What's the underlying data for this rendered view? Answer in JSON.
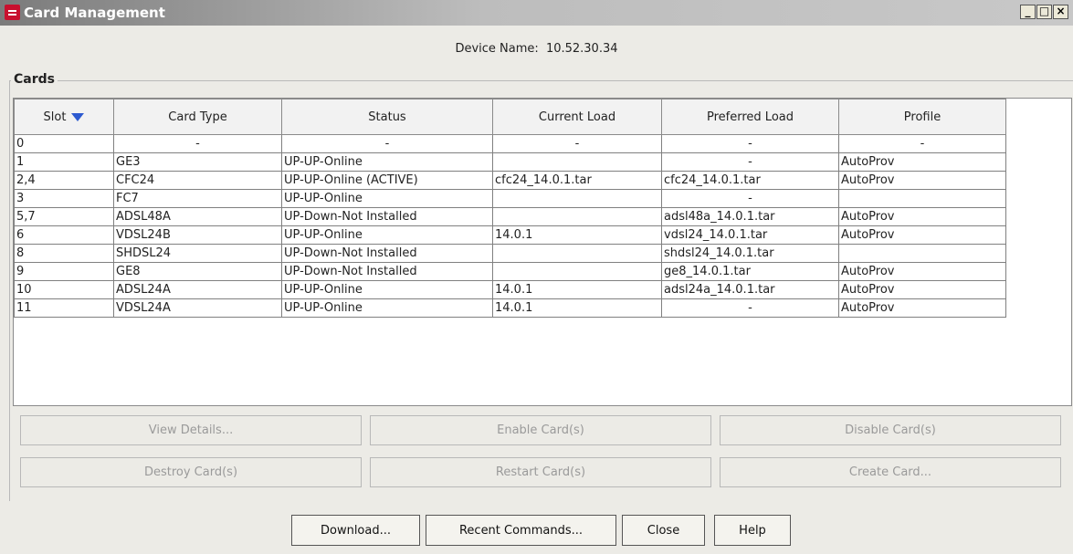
{
  "window": {
    "title": "Card Management",
    "controls": {
      "minimize": "_",
      "maximize": "□",
      "close": "×"
    }
  },
  "device": {
    "label": "Device Name:",
    "value": "10.52.30.34"
  },
  "cards_group": {
    "label": "Cards"
  },
  "table": {
    "columns": [
      "Slot",
      "Card Type",
      "Status",
      "Current Load",
      "Preferred Load",
      "Profile"
    ],
    "sort_column": "Slot",
    "sort_direction": "descending",
    "rows": [
      [
        "0",
        "-",
        "-",
        "-",
        "-",
        "-"
      ],
      [
        "1",
        "GE3",
        "UP-UP-Online",
        "",
        "-",
        "AutoProv"
      ],
      [
        "2,4",
        "CFC24",
        "UP-UP-Online (ACTIVE)",
        "cfc24_14.0.1.tar",
        "cfc24_14.0.1.tar",
        "AutoProv"
      ],
      [
        "3",
        "FC7",
        "UP-UP-Online",
        "",
        "-",
        ""
      ],
      [
        "5,7",
        "ADSL48A",
        "UP-Down-Not Installed",
        "",
        "adsl48a_14.0.1.tar",
        "AutoProv"
      ],
      [
        "6",
        "VDSL24B",
        "UP-UP-Online",
        "14.0.1",
        "vdsl24_14.0.1.tar",
        "AutoProv"
      ],
      [
        "8",
        "SHDSL24",
        "UP-Down-Not Installed",
        "",
        "shdsl24_14.0.1.tar",
        ""
      ],
      [
        "9",
        "GE8",
        "UP-Down-Not Installed",
        "",
        "ge8_14.0.1.tar",
        "AutoProv"
      ],
      [
        "10",
        "ADSL24A",
        "UP-UP-Online",
        "14.0.1",
        "adsl24a_14.0.1.tar",
        "AutoProv"
      ],
      [
        "11",
        "VDSL24A",
        "UP-UP-Online",
        "14.0.1",
        "-",
        "AutoProv"
      ]
    ]
  },
  "actions": {
    "view_details": "View Details...",
    "enable_cards": "Enable Card(s)",
    "disable_cards": "Disable Card(s)",
    "destroy_cards": "Destroy Card(s)",
    "restart_cards": "Restart Card(s)",
    "create_card": "Create Card..."
  },
  "footer": {
    "download": "Download...",
    "recent_commands": "Recent Commands...",
    "close": "Close",
    "help": "Help"
  },
  "colors": {
    "title_bar": "#9a9a9a",
    "app_icon": "#c8102e",
    "sort_arrow": "#2d5ad0",
    "disabled_text": "#9a9a9a"
  }
}
